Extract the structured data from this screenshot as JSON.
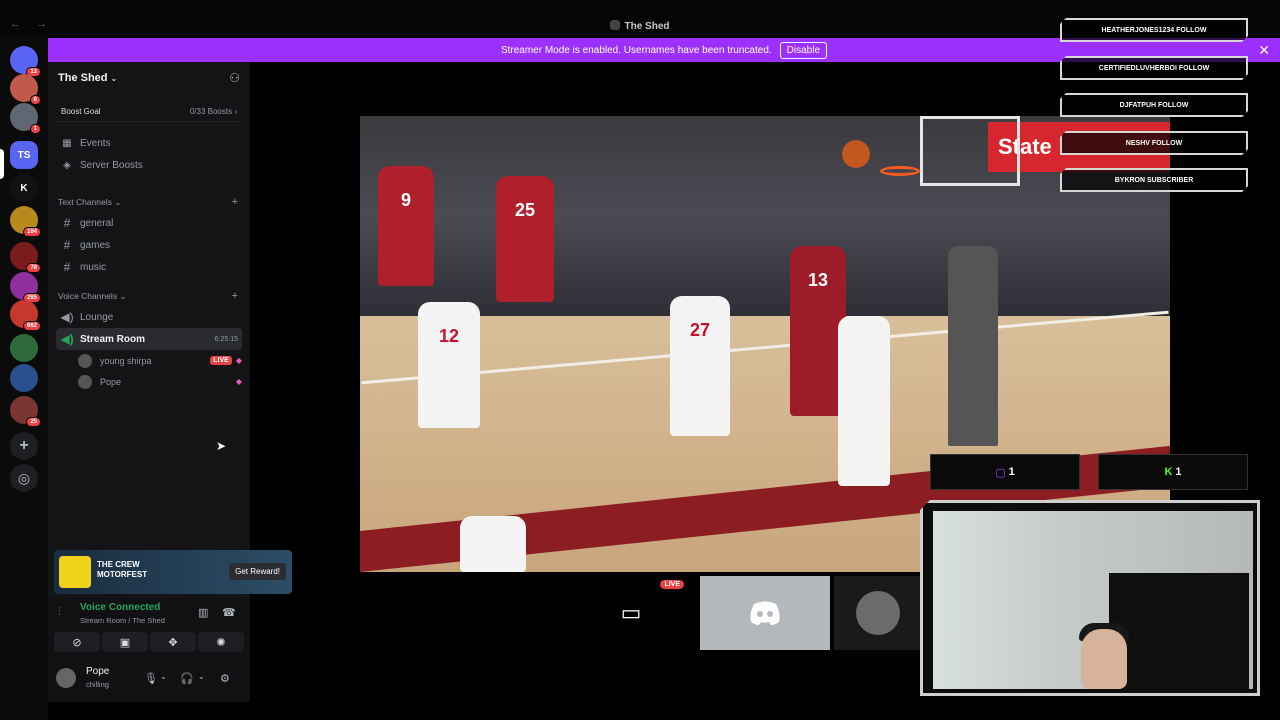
{
  "window": {
    "nav_arrows": "← →",
    "title": "The Shed"
  },
  "banner": {
    "text": "Streamer Mode is enabled. Usernames have been truncated.",
    "disable_label": "Disable",
    "close_glyph": "✕"
  },
  "rail": {
    "servers": [
      {
        "name": "Discord Home",
        "abbr": "",
        "badge": "13",
        "color": "#5865f2"
      },
      {
        "name": "Server",
        "abbr": "",
        "badge": "6",
        "color": "#c05a4d"
      },
      {
        "name": "Discord",
        "abbr": "",
        "badge": "1",
        "color": "#5f6773"
      },
      {
        "name": "TS",
        "abbr": "TS",
        "badge": "",
        "color": "#5865f2"
      },
      {
        "name": "Kick",
        "abbr": "K",
        "badge": "",
        "color": "#111"
      },
      {
        "name": "Server",
        "abbr": "",
        "badge": "104",
        "color": "#b88a1d"
      },
      {
        "name": "Server",
        "abbr": "",
        "badge": "78",
        "color": "#7a1c1c"
      },
      {
        "name": "Server",
        "abbr": "",
        "badge": "285",
        "color": "#8f2f9e"
      },
      {
        "name": "Server",
        "abbr": "",
        "badge": "662",
        "color": "#c6372e"
      },
      {
        "name": "Server",
        "abbr": "",
        "badge": "",
        "color": "#2f6b3c"
      },
      {
        "name": "Server",
        "abbr": "",
        "badge": "",
        "color": "#2a4e8e"
      },
      {
        "name": "Server",
        "abbr": "",
        "badge": "25",
        "color": "#7a3535"
      }
    ],
    "add_glyph": "+",
    "discover_glyph": "◎"
  },
  "sidebar": {
    "server_name": "The Shed",
    "boost_goal_label": "Boost Goal",
    "boost_goal_count": "0/33 Boosts",
    "events_label": "Events",
    "server_boosts_label": "Server Boosts",
    "text_category": "Text Channels",
    "text_channels": [
      "general",
      "games",
      "music"
    ],
    "voice_category": "Voice Channels",
    "voice_channels": {
      "lounge": "Lounge",
      "stream_room": "Stream Room",
      "stream_room_timer": "6:25:15"
    },
    "voice_users": [
      {
        "name": "young shirpa",
        "live": "LIVE"
      },
      {
        "name": "Pope",
        "live": ""
      }
    ]
  },
  "ad": {
    "brand_line1": "THE CREW",
    "brand_line2": "MOTORFEST",
    "cta": "Get Reward!"
  },
  "voice_panel": {
    "status": "Voice Connected",
    "location": "Stream Room / The Shed",
    "username": "Pope",
    "user_status": "chilling"
  },
  "video": {
    "sign_text": "State",
    "jersey_numbers": [
      "9",
      "25",
      "12",
      "27",
      "13"
    ]
  },
  "overlay": {
    "events": [
      "HEATHERJONES1234 FOLLOW",
      "CERTIFIEDLUVHERBOI FOLLOW",
      "DJFATPUH FOLLOW",
      "NESHV FOLLOW",
      "BYKRON SUBSCRIBER"
    ],
    "twitch_count": "1",
    "kick_count": "1"
  },
  "thumbnails": {
    "live_label": "LIVE"
  },
  "colors": {
    "banner": "#9b30ff",
    "voice_connected": "#23a55a",
    "live": "#ed4245",
    "twitch": "#9146ff",
    "kick": "#53fc18"
  }
}
